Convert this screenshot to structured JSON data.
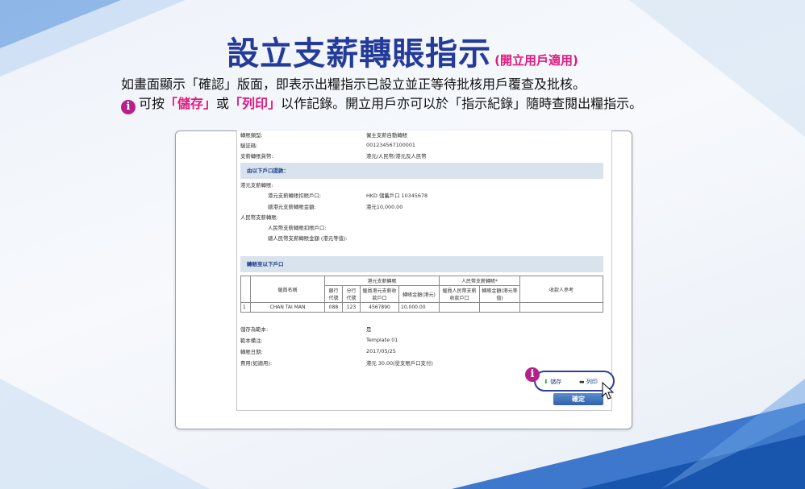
{
  "header": {
    "title": "設立支薪轉賬指示",
    "title_sub": "(開立用戶適用)"
  },
  "desc": {
    "line1": "如畫面顯示「確認」版面，即表示出糧指示已設立並正等待批核用戶覆查及批核。",
    "line2_a": "可按",
    "save_word": "「儲存」",
    "line2_or": "或",
    "print_word": "「列印」",
    "line2_b": "以作記錄。開立用戶亦可以於「指示紀錄」隨時查閱出糧指示。"
  },
  "form": {
    "type_label": "轉賬類型:",
    "type_value": "僱主支薪自動轉賬",
    "ref_label": "驗証碼:",
    "ref_value": "001234567100001",
    "currency_label": "支薪轉賬貨幣:",
    "currency_value": "港元/人民幣/港元及人民幣",
    "section_from": "由以下戶口提款：",
    "hkd_label": "港元支薪轉賬:",
    "hkd_account_label": "港元支薪轉賬扣賬戶口:",
    "hkd_account_value": "HKD 儲蓄戶口 10345678",
    "hkd_total_label": "總港元支薪轉賬金額:",
    "hkd_total_value": "港元10,000.00",
    "rmb_label": "人民幣支薪轉賬:",
    "rmb_account_label": "人民幣支薪轉賬扣賬戶口:",
    "rmb_total_label": "總人民幣支薪轉賬金額 (港元等值):",
    "section_to": "轉賬至以下戶口",
    "table": {
      "group_hkd": "港元支薪轉賬",
      "group_rmb": "人民幣支薪轉賬*",
      "col_name": "僱員名稱",
      "col_bank": "銀行代號",
      "col_branch": "分行代號",
      "col_acct": "僱員港元支薪收款戶口",
      "col_amount": "轉賬金額(港元)",
      "col_rmb_acct": "僱員人民幣支薪收款戶口",
      "col_rmb_amount": "轉賬金額(港元等值)",
      "col_ref": "收款人參考",
      "rows": [
        {
          "no": "1",
          "name": "CHAN TAI MAN",
          "bank": "088",
          "branch": "123",
          "acct": "4567890",
          "amount": "10,000.00"
        }
      ]
    },
    "template_label": "儲存為範本:",
    "template_value": "是",
    "template_name_label": "範本備注:",
    "template_name_value": "Template 01",
    "date_label": "轉賬日期:",
    "date_value": "2017/05/25",
    "fee_label": "費用(如適用):",
    "fee_value": "港元 30.00(從支賬戶口支付)"
  },
  "actions": {
    "save_label": "儲存",
    "print_label": "列印",
    "confirm_label": "確定"
  },
  "colors": {
    "title": "#243b9a",
    "accent": "#e0197e",
    "info": "#b5208a",
    "section_bar": "#d9e3ee"
  }
}
